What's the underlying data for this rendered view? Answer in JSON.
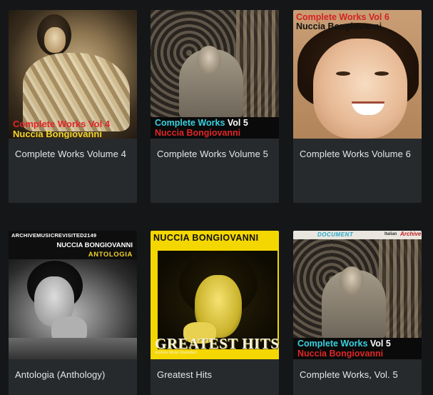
{
  "albums": [
    {
      "title": "Complete Works Volume 4",
      "cover_text": [
        "Complete Works Vol 4",
        "Nuccia Bongiovanni"
      ]
    },
    {
      "title": "Complete Works Volume 5",
      "cover_text": [
        "Complete Works",
        "Vol 5",
        "Nuccia Bongiovanni"
      ]
    },
    {
      "title": "Complete Works Volume 6",
      "cover_text": [
        "Complete Works Vol 6",
        "Nuccia Bongiovanni"
      ]
    },
    {
      "title": "Antologia (Anthology)",
      "cover_text": [
        "ARCHIVEMUSICREVISITED2149",
        "NUCCIA BONGIOVANNI",
        "ANTOLOGIA"
      ]
    },
    {
      "title": "Greatest Hits",
      "cover_text": [
        "NUCCIA BONGIOVANNI",
        "GREATEST HITS",
        "Archive Music Revisited"
      ]
    },
    {
      "title": "Complete Works, Vol. 5",
      "cover_text": [
        "DOCUMENT",
        "Italian",
        "Archive",
        "Complete Works",
        "Vol 5",
        "Nuccia Bongiovanni"
      ]
    }
  ],
  "colors": {
    "page_background": "#151618",
    "card_background": "#272a2d",
    "caption_text": "#e6e6e6"
  }
}
